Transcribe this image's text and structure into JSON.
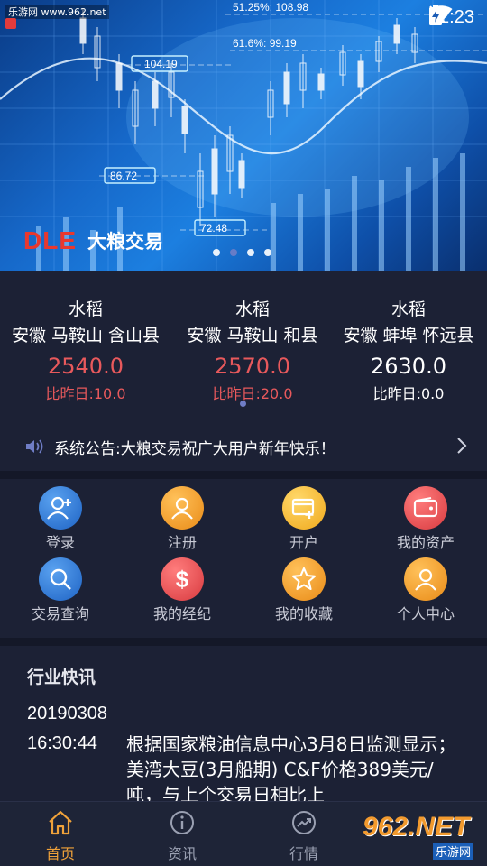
{
  "status_bar": {
    "watermark": "乐游网 www.962.net",
    "time": "12:23"
  },
  "banner": {
    "logo_letters": "DLE",
    "logo_name": "大粮交易",
    "chart_labels": [
      "51.25%: 108.98",
      "61.6%: 99.19",
      "104.19",
      "86.72",
      "72.48"
    ],
    "slides": 4,
    "active_slide": 2
  },
  "quotes": {
    "items": [
      {
        "name": "水稻",
        "place": "安徽 马鞍山 含山县",
        "price": "2540.0",
        "change": "比昨日:10.0",
        "trend": "up"
      },
      {
        "name": "水稻",
        "place": "安徽 马鞍山 和县",
        "price": "2570.0",
        "change": "比昨日:20.0",
        "trend": "up"
      },
      {
        "name": "水稻",
        "place": "安徽 蚌埠 怀远县",
        "price": "2630.0",
        "change": "比昨日:0.0",
        "trend": "flat"
      }
    ],
    "notice": "系统公告:大粮交易祝广大用户新年快乐！"
  },
  "menu": {
    "items": [
      {
        "label": "登录",
        "icon": "user-add-icon"
      },
      {
        "label": "注册",
        "icon": "user-icon"
      },
      {
        "label": "开户",
        "icon": "open-account-icon"
      },
      {
        "label": "我的资产",
        "icon": "wallet-icon"
      },
      {
        "label": "交易查询",
        "icon": "search-icon"
      },
      {
        "label": "我的经纪",
        "icon": "dollar-icon"
      },
      {
        "label": "我的收藏",
        "icon": "star-icon"
      },
      {
        "label": "个人中心",
        "icon": "person-icon"
      }
    ]
  },
  "news": {
    "title": "行业快讯",
    "date": "20190308",
    "time": "16:30:44",
    "content": "根据国家粮油信息中心3月8日监测显示；美湾大豆(3月船期) C&F价格389美元/吨，与上个交易日相比上"
  },
  "tabbar": {
    "tabs": [
      {
        "label": "首页",
        "icon": "home-icon",
        "active": true
      },
      {
        "label": "资讯",
        "icon": "info-icon",
        "active": false
      },
      {
        "label": "行情",
        "icon": "trend-icon",
        "active": false
      }
    ]
  },
  "watermark_br": {
    "main": "962.NET",
    "sub": "乐游网"
  },
  "colors": {
    "rise": "#e8595c",
    "accent": "#f0a23a",
    "background": "#1c2135"
  }
}
